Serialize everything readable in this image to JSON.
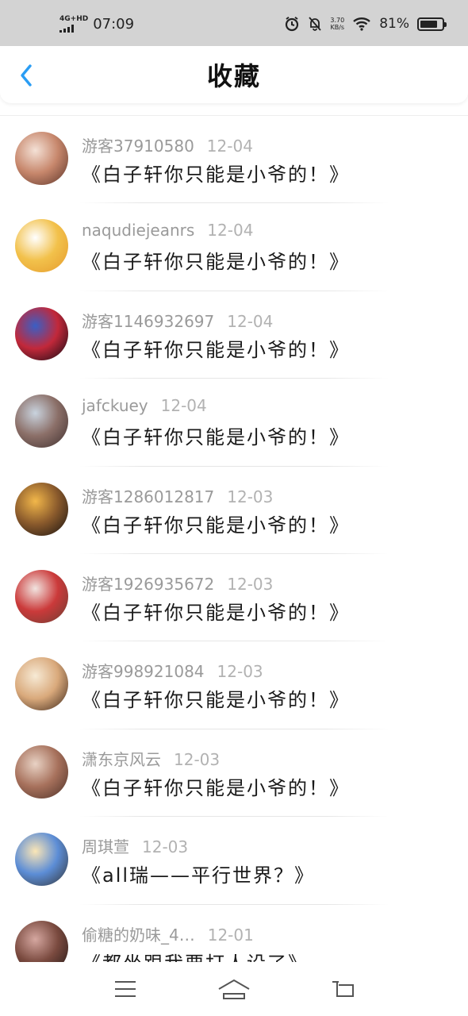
{
  "status_bar": {
    "network": "4G+HD",
    "time": "07:09",
    "speed_value": "3.70",
    "speed_unit": "KB/s",
    "battery_text": "81%",
    "battery_level": 0.81
  },
  "header": {
    "title": "收藏",
    "back_icon": "chevron-left-icon"
  },
  "items": [
    {
      "user": "游客37910580",
      "date": "12-04",
      "title": "《白子轩你只能是小爷的！》",
      "avatar_colors": [
        "#f4e1d6",
        "#c7876c",
        "#5a3328"
      ]
    },
    {
      "user": "naqudiejeanrs",
      "date": "12-04",
      "title": "《白子轩你只能是小爷的！》",
      "avatar_colors": [
        "#ffffff",
        "#f2c14b",
        "#e59a2c"
      ]
    },
    {
      "user": "游客1146932697",
      "date": "12-04",
      "title": "《白子轩你只能是小爷的！》",
      "avatar_colors": [
        "#3a5fc5",
        "#c2283a",
        "#0a0a12"
      ]
    },
    {
      "user": "jafckuey",
      "date": "12-04",
      "title": "《白子轩你只能是小爷的！》",
      "avatar_colors": [
        "#c9d3de",
        "#8b6f68",
        "#3e2f2e"
      ]
    },
    {
      "user": "游客1286012817",
      "date": "12-03",
      "title": "《白子轩你只能是小爷的！》",
      "avatar_colors": [
        "#f2b74a",
        "#8a5a2c",
        "#141010"
      ]
    },
    {
      "user": "游客1926935672",
      "date": "12-03",
      "title": "《白子轩你只能是小爷的！》",
      "avatar_colors": [
        "#f1e4e0",
        "#cb3a3a",
        "#6a3d33"
      ]
    },
    {
      "user": "游客998921084",
      "date": "12-03",
      "title": "《白子轩你只能是小爷的！》",
      "avatar_colors": [
        "#f7ead5",
        "#d9a97b",
        "#3a2418"
      ]
    },
    {
      "user": "潇东京风云",
      "date": "12-03",
      "title": "《白子轩你只能是小爷的！》",
      "avatar_colors": [
        "#e8d2c4",
        "#a7715c",
        "#4b2f26"
      ]
    },
    {
      "user": "周琪萱",
      "date": "12-03",
      "title": "《all瑞——平行世界？》",
      "avatar_colors": [
        "#fbe6b6",
        "#5c8dd6",
        "#333333"
      ]
    },
    {
      "user": "偷糖的奶味_4…",
      "date": "12-01",
      "title": "《都坐跟我要打人设了》",
      "avatar_colors": [
        "#d5a7a0",
        "#7a4a3f",
        "#201514"
      ]
    }
  ],
  "nav_bar": {
    "menu_icon": "menu-icon",
    "home_icon": "home-icon",
    "back_icon": "return-icon"
  }
}
